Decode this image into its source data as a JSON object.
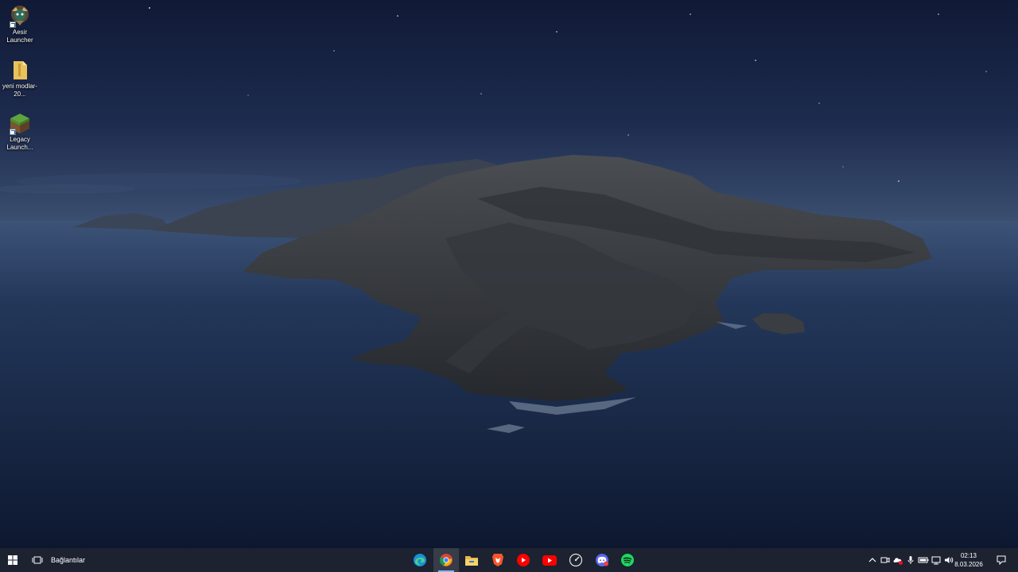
{
  "desktop": {
    "icons": [
      {
        "name": "aesir-launcher",
        "label": "Aesir Launcher",
        "icon": "aesir-launcher-icon"
      },
      {
        "name": "yeni-modlar",
        "label": "yeni modlar-20...",
        "icon": "folder-icon"
      },
      {
        "name": "legacy-launcher",
        "label": "Legacy Launch...",
        "icon": "minecraft-grass-block-icon"
      }
    ]
  },
  "taskbar": {
    "start_icon": "windows-start-icon",
    "task_view_icon": "task-view-icon",
    "links_label": "Bağlantılar",
    "apps": [
      {
        "name": "edge",
        "icon": "microsoft-edge-icon",
        "state": "pinned"
      },
      {
        "name": "chrome",
        "icon": "google-chrome-icon",
        "state": "active"
      },
      {
        "name": "file-explorer",
        "icon": "file-explorer-icon",
        "state": "pinned"
      },
      {
        "name": "brave",
        "icon": "brave-browser-icon",
        "state": "pinned"
      },
      {
        "name": "youtube-music",
        "icon": "youtube-music-icon",
        "state": "pinned"
      },
      {
        "name": "youtube",
        "icon": "youtube-icon",
        "state": "pinned"
      },
      {
        "name": "speed-app",
        "icon": "speedometer-icon",
        "state": "pinned"
      },
      {
        "name": "discord",
        "icon": "discord-icon",
        "state": "pinned"
      },
      {
        "name": "spotify",
        "icon": "spotify-icon",
        "state": "pinned"
      }
    ],
    "tray": {
      "icons": [
        "chevron-up-icon",
        "meet-now-icon",
        "cloud-sync-icon",
        "microphone-icon",
        "battery-icon",
        "network-icon",
        "volume-icon"
      ],
      "time": "02:13",
      "date": "8.03.2026",
      "notification_icon": "notification-icon"
    }
  },
  "colors": {
    "taskbar_bg": "#1c2230",
    "sky_top": "#131d3a",
    "sea": "#16263f",
    "accent_active": "#8ab4f8"
  }
}
